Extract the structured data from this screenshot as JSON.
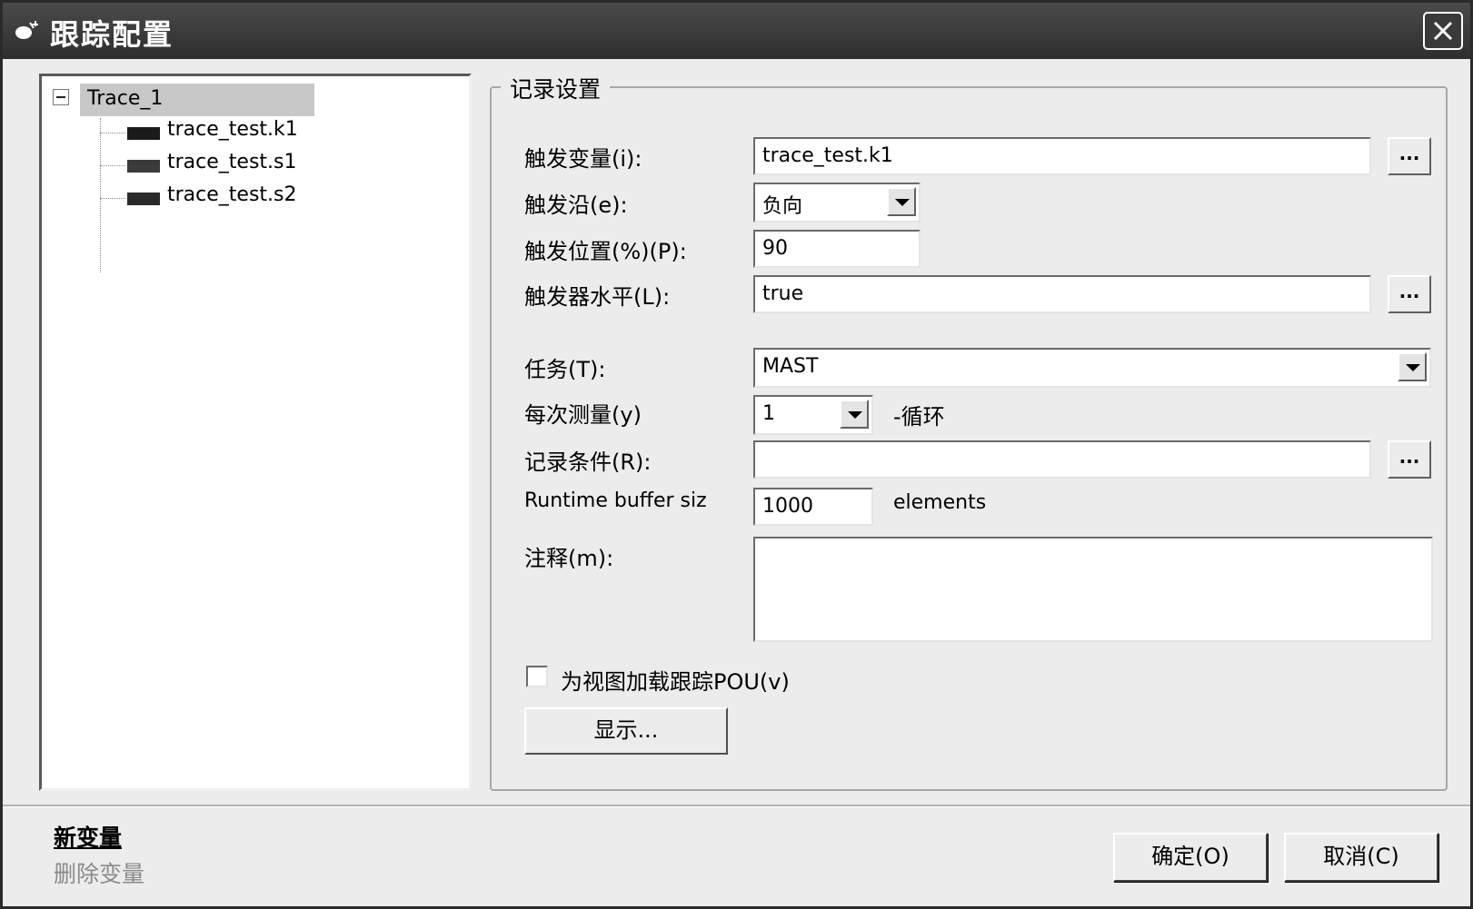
{
  "window": {
    "title": "跟踪配置"
  },
  "tree": {
    "root": "Trace_1",
    "children": [
      {
        "label": "trace_test.k1",
        "color": "#1b1b1b"
      },
      {
        "label": "trace_test.s1",
        "color": "#3a3a3a"
      },
      {
        "label": "trace_test.s2",
        "color": "#2a2a2a"
      }
    ]
  },
  "record_settings": {
    "group_title": "记录设置",
    "trigger_variable": {
      "label": "触发变量(i):",
      "value": "trace_test.k1",
      "button": "..."
    },
    "trigger_edge": {
      "label": "触发沿(e):",
      "value": "负向"
    },
    "trigger_position": {
      "label": "触发位置(%)(P):",
      "value": "90"
    },
    "trigger_level": {
      "label": "触发器水平(L):",
      "value": "true",
      "button": "..."
    },
    "task": {
      "label": "任务(T):",
      "value": "MAST"
    },
    "measure_every": {
      "label": "每次测量(y)",
      "value": "1",
      "suffix": "-循环"
    },
    "record_condition": {
      "label": "记录条件(R):",
      "value": "",
      "button": "..."
    },
    "buffer_size": {
      "label": "Runtime buffer siz",
      "value": "1000",
      "suffix": "elements"
    },
    "comment": {
      "label": "注释(m):",
      "value": ""
    },
    "load_pou": {
      "label": "为视图加载跟踪POU(v)",
      "checked": false
    },
    "show_button": "显示..."
  },
  "footer": {
    "new_variable": "新变量",
    "delete_variable": "删除变量",
    "ok_button": "确定(O)",
    "cancel_button": "取消(C)"
  }
}
